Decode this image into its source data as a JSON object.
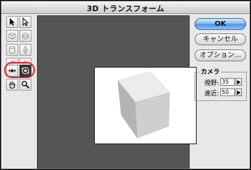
{
  "window": {
    "title": "3D トランスフォーム"
  },
  "tools": [
    {
      "name": "selection-arrow-tool",
      "state": "normal"
    },
    {
      "name": "direct-selection-tool",
      "state": "normal"
    },
    {
      "name": "cube-tool",
      "state": "disabled"
    },
    {
      "name": "sphere-tool",
      "state": "disabled"
    },
    {
      "name": "cylinder-tool",
      "state": "disabled"
    },
    {
      "name": "convert-anchor-tool",
      "state": "disabled"
    },
    {
      "name": "add-anchor-tool",
      "state": "disabled"
    },
    {
      "name": "delete-anchor-tool",
      "state": "disabled"
    },
    {
      "name": "pan-camera-tool",
      "state": "normal"
    },
    {
      "name": "trackball-tool",
      "state": "active"
    },
    {
      "name": "hand-tool",
      "state": "normal"
    },
    {
      "name": "zoom-tool",
      "state": "normal"
    }
  ],
  "buttons": {
    "ok": "OK",
    "cancel": "キャンセル",
    "options": "オプション..."
  },
  "camera": {
    "group_label": "カメラ",
    "fov_label": "視野:",
    "fov_value": "35",
    "dolly_label": "遠近:",
    "dolly_value": "50"
  },
  "colors": {
    "highlight": "#e0222b",
    "preview_bg": "#555555",
    "ok_button": "#5f9de6"
  }
}
